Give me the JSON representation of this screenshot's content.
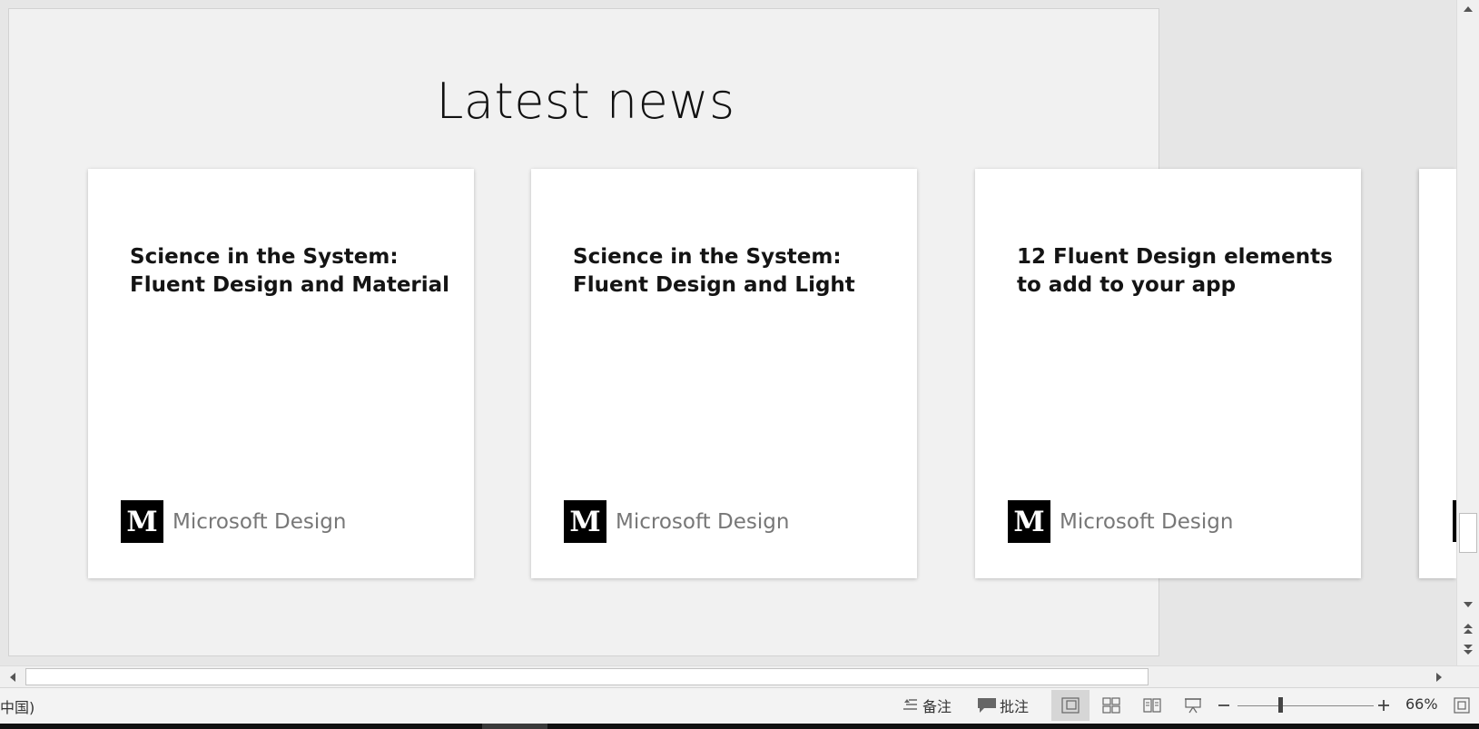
{
  "slide": {
    "title": "Latest news"
  },
  "cards": [
    {
      "title": "Science in the System: Fluent Design and Material",
      "logo": "M",
      "source": "Microsoft Design"
    },
    {
      "title": "Science in the System: Fluent Design and Light",
      "logo": "M",
      "source": "Microsoft Design"
    },
    {
      "title": "12 Fluent Design elements to add to your app",
      "logo": "M",
      "source": "Microsoft Design"
    }
  ],
  "statusbar": {
    "language": "中国)",
    "notes_label": "备注",
    "comments_label": "批注",
    "zoom_percent": "66%",
    "zoom_level": 0.66
  },
  "icons": {
    "notes": "notes-icon",
    "comments": "comment-icon",
    "normal_view": "normal-view-icon",
    "slide_sorter": "slide-sorter-icon",
    "reading_view": "reading-view-icon",
    "slideshow": "slideshow-icon",
    "zoom_out": "minus-icon",
    "zoom_in": "plus-icon",
    "fit": "fit-to-window-icon"
  }
}
